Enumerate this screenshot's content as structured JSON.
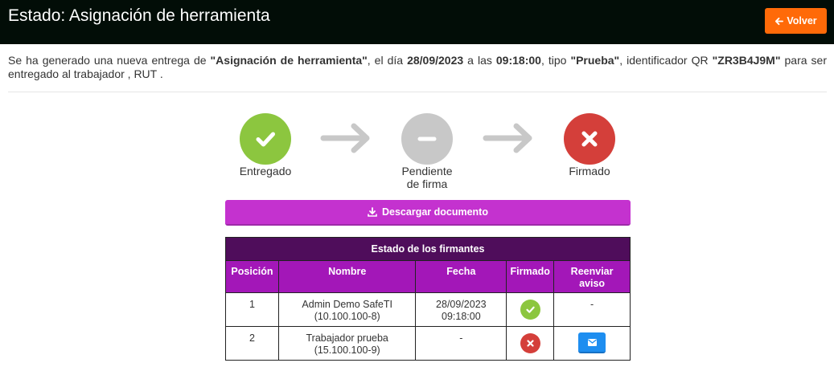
{
  "header": {
    "title": "Estado: Asignación de herramienta",
    "back_label": "Volver"
  },
  "intro": {
    "t1": "Se ha generado una nueva entrega de ",
    "b1": "\"Asignación de herramienta\"",
    "t2": ", el día ",
    "b2": "28/09/2023",
    "t3": " a las ",
    "b3": "09:18:00",
    "t4": ", tipo ",
    "b4": "\"Prueba\"",
    "t5": ", identificador QR ",
    "b5": "\"ZR3B4J9M\"",
    "t6": " para ser entregado al trabajador , RUT ."
  },
  "steps": [
    {
      "label": "Entregado",
      "state": "done",
      "color": "#8cc63f",
      "icon": "check-icon"
    },
    {
      "label_line1": "Pendiente",
      "label_line2": "de firma",
      "state": "pending",
      "color": "#c8c8c8",
      "icon": "minus-icon"
    },
    {
      "label": "Firmado",
      "state": "failed",
      "color": "#d43f3a",
      "icon": "x-icon"
    }
  ],
  "download": {
    "label": "Descargar documento"
  },
  "signers": {
    "title": "Estado de los firmantes",
    "headers": {
      "position": "Posición",
      "name": "Nombre",
      "date": "Fecha",
      "signed": "Firmado",
      "resend_line1": "Reenviar",
      "resend_line2": "aviso"
    },
    "rows": [
      {
        "position": "1",
        "name": "Admin Demo SafeTI",
        "rut": "(10.100.100-8)",
        "date": "28/09/2023",
        "time": "09:18:00",
        "signed": true,
        "resend": "-"
      },
      {
        "position": "2",
        "name": "Trabajador prueba",
        "rut": "(15.100.100-9)",
        "date": "-",
        "time": "",
        "signed": false,
        "resend": "mail-button"
      }
    ]
  },
  "colors": {
    "header_bg": "#020d07",
    "back_button": "#ff6a08",
    "download_button": "#c432cf",
    "table_title_bg": "#4f0d5b",
    "table_header_bg": "#a317b8",
    "mail_button": "#1e8ef0"
  }
}
